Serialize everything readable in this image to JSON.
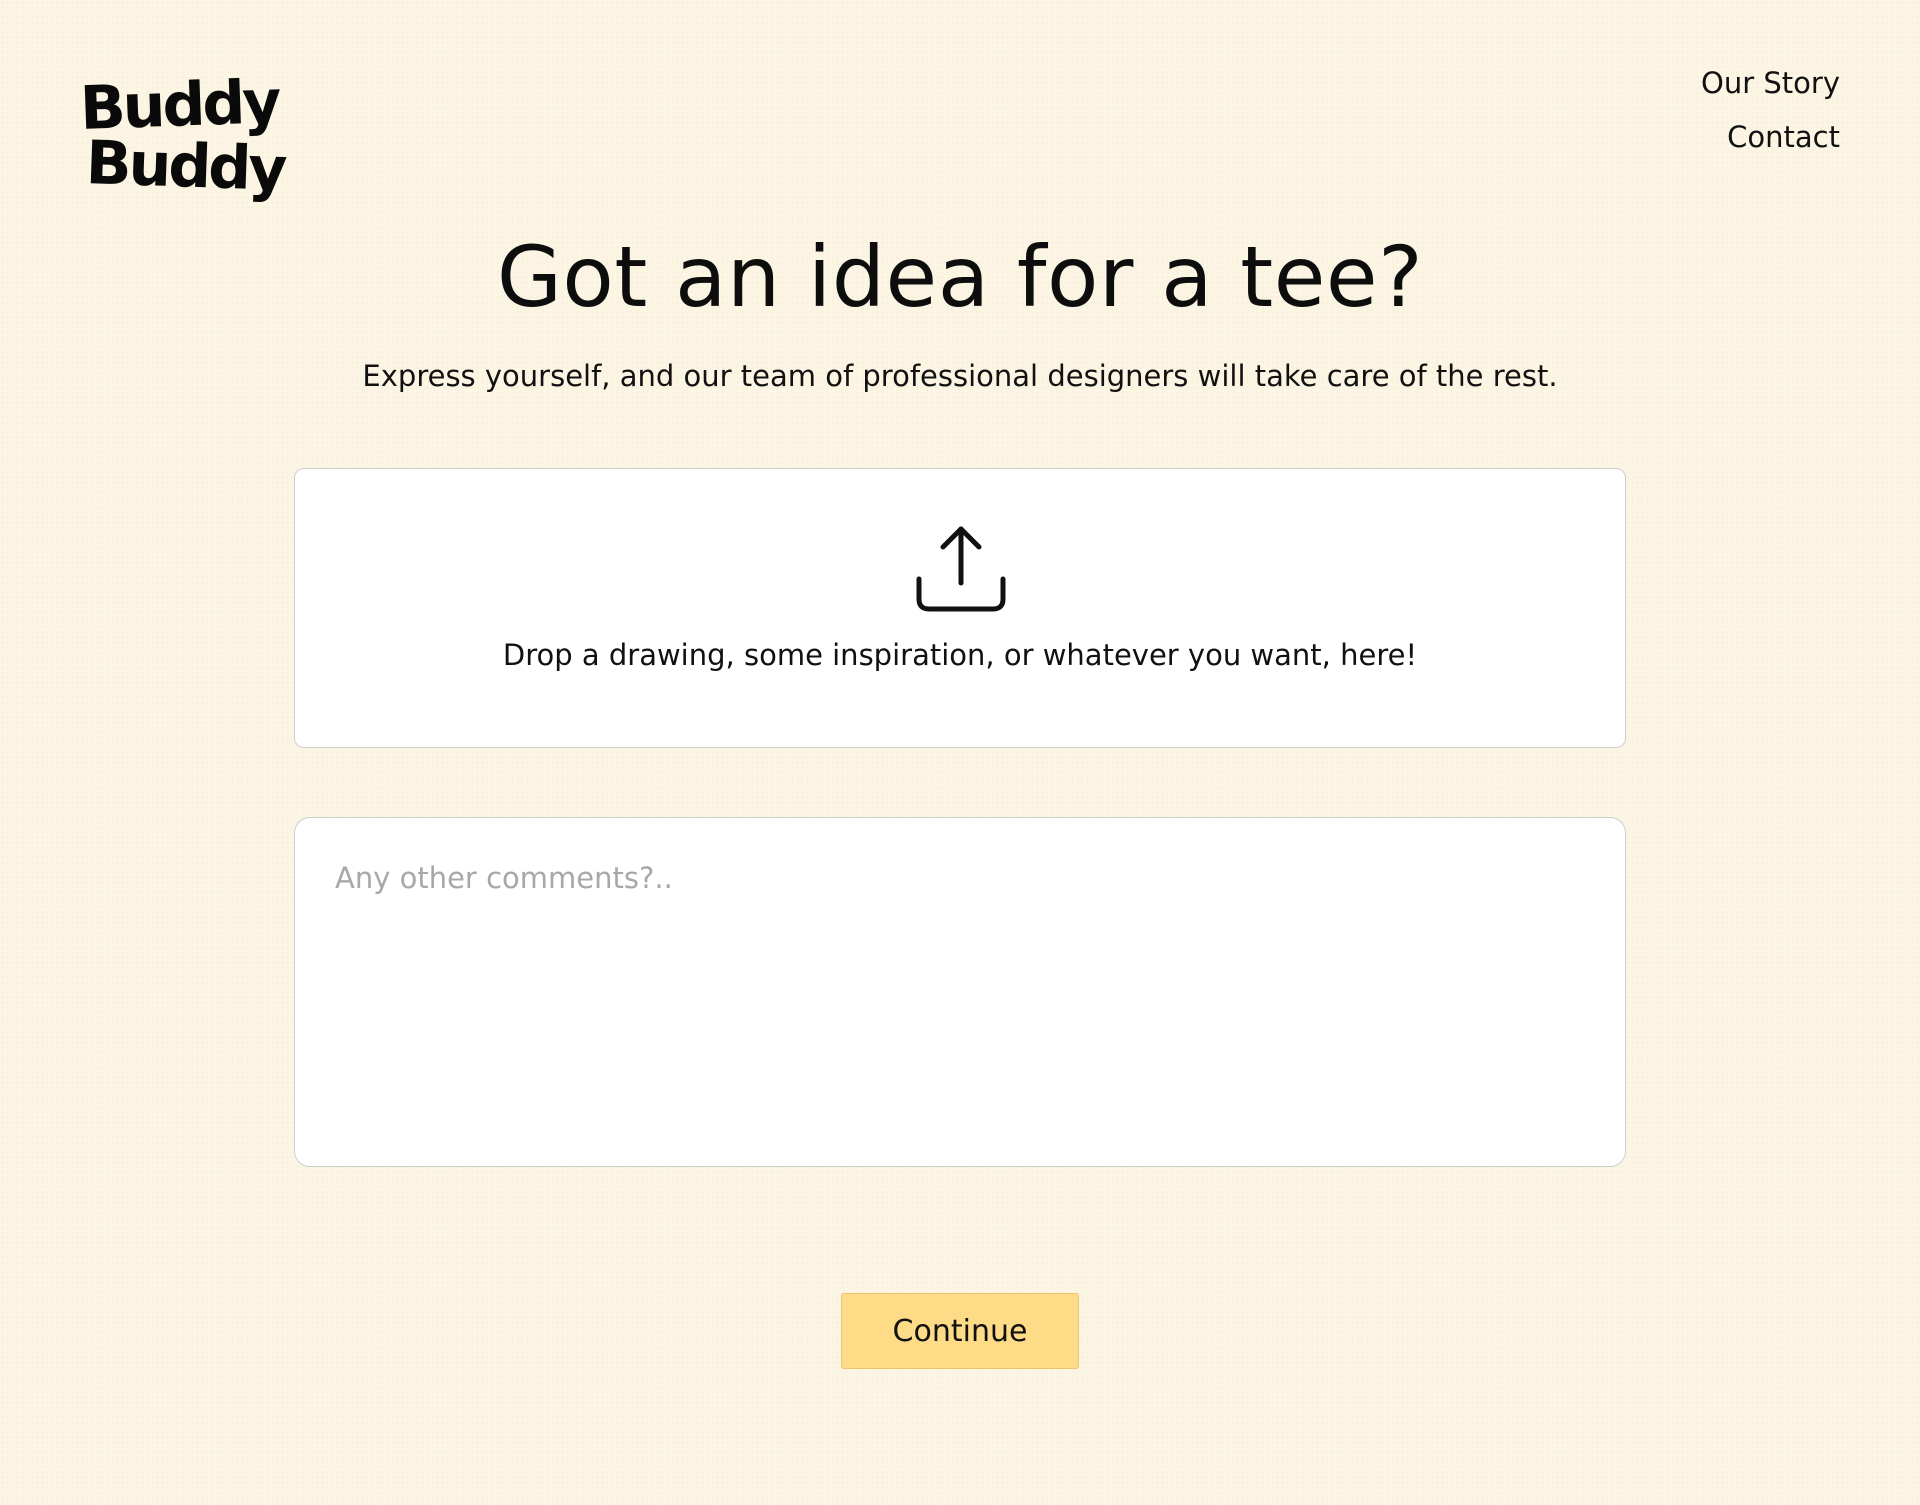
{
  "brand": {
    "logo_line1": "Buddy",
    "logo_line2": "Buddy"
  },
  "nav": {
    "items": [
      {
        "label": "Our Story"
      },
      {
        "label": "Contact"
      }
    ]
  },
  "hero": {
    "title": "Got an idea for a tee?",
    "subtitle": "Express yourself, and our team of professional designers will take care of the rest."
  },
  "upload": {
    "icon": "upload-icon",
    "label": "Drop a drawing, some inspiration, or whatever you want, here!"
  },
  "comments": {
    "value": "",
    "placeholder": "Any other comments?.."
  },
  "actions": {
    "continue_label": "Continue"
  },
  "colors": {
    "background": "#fcf5e3",
    "button": "#fedb86",
    "placeholder": "#a8a8a8",
    "text": "#111111"
  }
}
